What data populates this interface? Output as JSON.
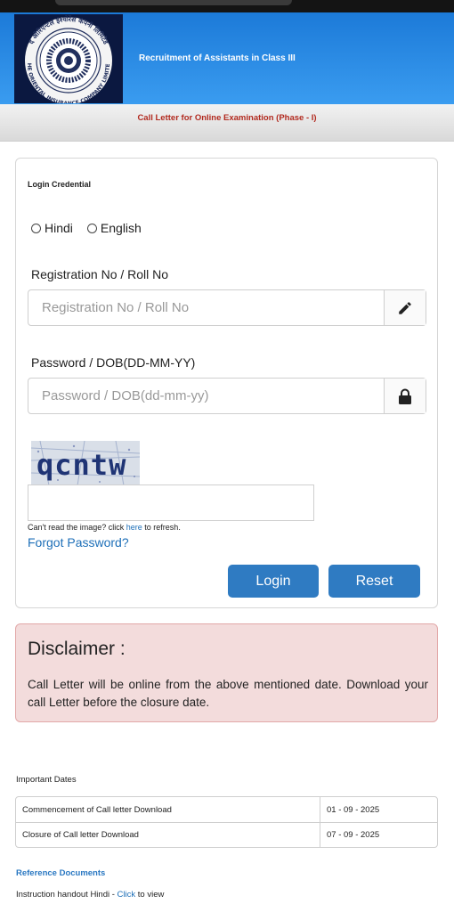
{
  "header": {
    "logo": {
      "icon": "insurance-company-seal-icon",
      "seal_text_top": "द ओरिएन्टल इंश्योरेंस कंपनी लिमिटेड",
      "seal_text_bottom": "THE ORIENTAL INSURANCE COMPANY LIMITED"
    },
    "title": "Recruitment of Assistants in Class III",
    "subtitle": "Call Letter for Online Examination (Phase - I)"
  },
  "login": {
    "heading": "Login Credential",
    "language_options": [
      "Hindi",
      "English"
    ],
    "registration": {
      "label": "Registration No / Roll No",
      "placeholder": "Registration No / Roll No",
      "icon": "pencil-icon"
    },
    "password": {
      "label": "Password / DOB(DD-MM-YY)",
      "placeholder": "Password / DOB(dd-mm-yy)",
      "icon": "lock-icon"
    },
    "captcha": {
      "image_text": "qcntw",
      "help_prefix": "Can't read the image? click ",
      "help_link": "here",
      "help_suffix": " to refresh."
    },
    "forgot_password": "Forgot Password?",
    "login_button": "Login",
    "reset_button": "Reset"
  },
  "disclaimer": {
    "title": "Disclaimer :",
    "text": "Call Letter will be online from the above mentioned date. Download your call Letter before the closure date."
  },
  "important_dates": {
    "heading": "Important Dates",
    "rows": [
      {
        "event": "Commencement of Call letter Download",
        "date": "01 - 09 - 2025"
      },
      {
        "event": "Closure of Call letter Download",
        "date": "07 - 09 - 2025"
      }
    ]
  },
  "reference": {
    "heading": "Reference Documents",
    "item_prefix": "Instruction handout Hindi - ",
    "item_link": "Click",
    "item_suffix": " to view"
  },
  "colors": {
    "banner": "#2a8ae6",
    "subtitle_red": "#b22a1f",
    "button_blue": "#2f7bc2",
    "disclaimer_bg": "#f3dcdc",
    "link_blue": "#1d6fb8"
  }
}
